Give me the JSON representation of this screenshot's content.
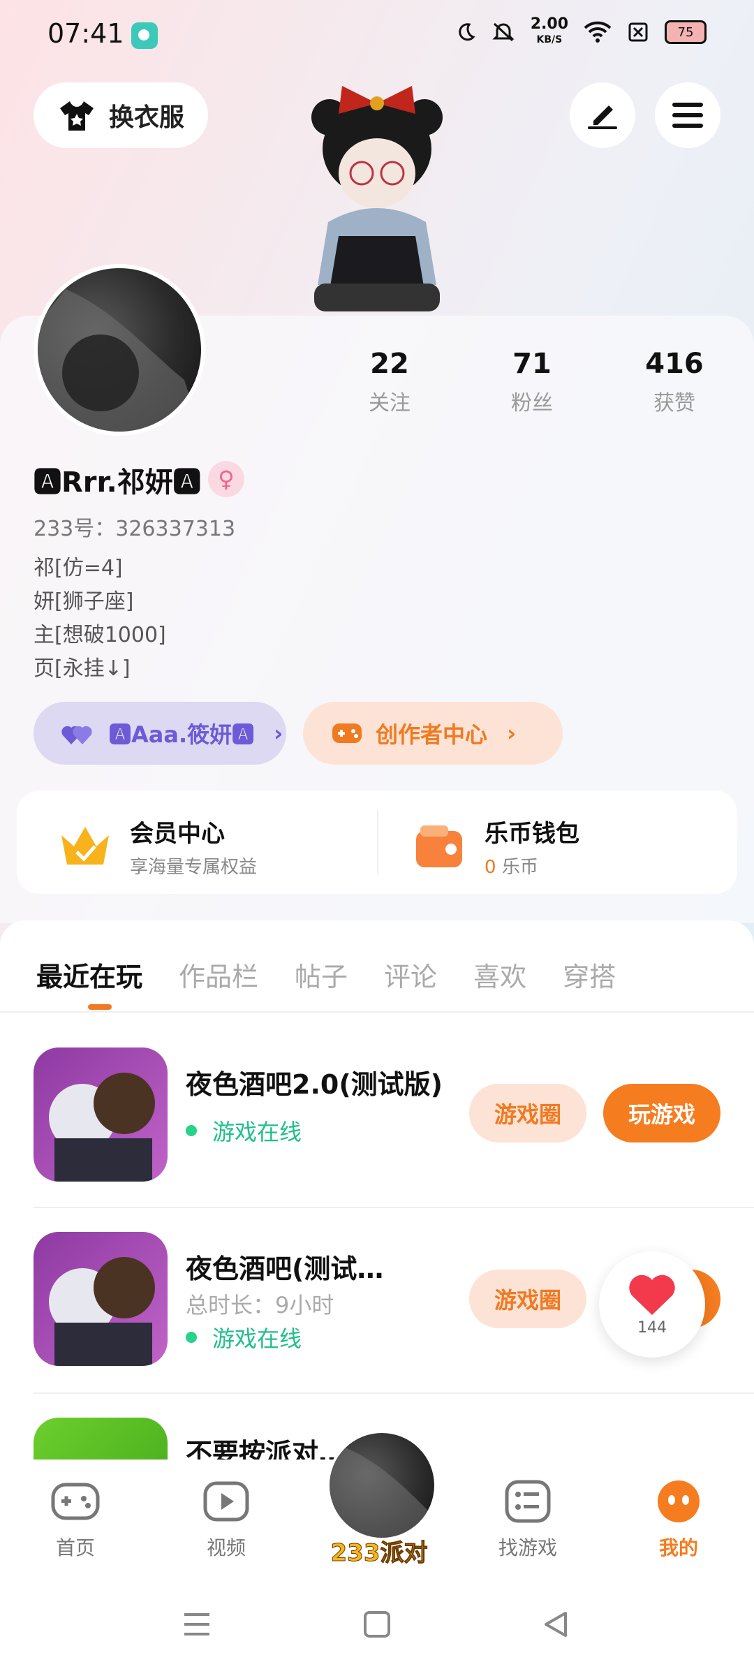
{
  "status_bar": {
    "time": "07:41",
    "net_speed_value": "2.00",
    "net_speed_unit": "KB/S",
    "battery": "75"
  },
  "header": {
    "dress_up_label": "换衣服"
  },
  "stats": [
    {
      "value": "22",
      "label": "关注"
    },
    {
      "value": "71",
      "label": "粉丝"
    },
    {
      "value": "416",
      "label": "获赞"
    }
  ],
  "profile": {
    "nickname": "🅰Rrr.祁妍🅰",
    "id_line": "233号：326337313",
    "bio": [
      "祁[仿=4]",
      "妍[狮子座]",
      "主[想破1000]",
      "页[永挂↓]"
    ]
  },
  "pills": {
    "friend_label": "🅰Aaa.筱妍🅰",
    "creator_label": "创作者中心"
  },
  "wallet": {
    "vip_title": "会员中心",
    "vip_sub": "享海量专属权益",
    "coins_title": "乐币钱包",
    "coins_amount": "0",
    "coins_unit": "乐币"
  },
  "tabs": [
    "最近在玩",
    "作品栏",
    "帖子",
    "评论",
    "喜欢",
    "穿搭"
  ],
  "games": [
    {
      "name": "夜色酒吧2.0(测试版)",
      "status": "游戏在线",
      "circle": "游戏圈",
      "play": "玩游戏"
    },
    {
      "name": "夜色酒吧(测试…",
      "duration": "总时长：9小时",
      "status": "游戏在线",
      "circle": "游戏圈"
    },
    {
      "name": "不要按派对…"
    }
  ],
  "like_count": "144",
  "nav": {
    "home": "首页",
    "video": "视频",
    "center": "233派对",
    "find": "找游戏",
    "mine": "我的"
  },
  "colors": {
    "accent": "#f57c1f",
    "online": "#1fbf8a",
    "friend_pill": "#ddd9f3",
    "creator_pill": "#fde3d6"
  }
}
